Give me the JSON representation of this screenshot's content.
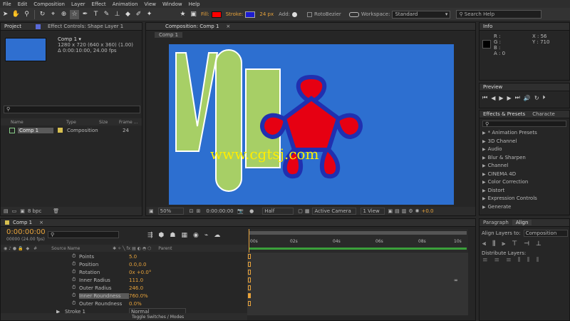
{
  "menu": [
    "File",
    "Edit",
    "Composition",
    "Layer",
    "Effect",
    "Animation",
    "View",
    "Window",
    "Help"
  ],
  "toolbar": {
    "fill_label": "Fill:",
    "fill_color": "#ff0000",
    "stroke_label": "Stroke:",
    "stroke_color": "#1c1cd0",
    "stroke_width": "24 px",
    "add_label": "Add:",
    "roto_label": "RotoBezier",
    "workspace_label": "Workspace:",
    "workspace_value": "Standard",
    "search_placeholder": "Search Help"
  },
  "project": {
    "tab_project": "Project",
    "tab_effect": "Effect Controls: Shape Layer 1",
    "comp_name": "Comp 1 ▾",
    "comp_size": "1280 x 720  (640 x 360) (1.00)",
    "comp_duration": "Δ 0:00:10:00, 24.00 fps",
    "search_icon": "⚲",
    "cols": [
      "Name",
      "Type",
      "Size",
      "Frame ..."
    ],
    "item_name": "Comp 1",
    "item_type": "Composition",
    "item_frames": "24",
    "bpc": "8 bpc"
  },
  "comp": {
    "tab": "Composition: Comp 1",
    "sub_tab": "Comp 1",
    "zoom": "50%",
    "timecode": "0:00:00:00",
    "resolution": "Half",
    "camera": "Active Camera",
    "view": "1 View",
    "exposure": "+0.0"
  },
  "watermark": "www.cgtsj.com",
  "info": {
    "tab": "Info",
    "r": "R :",
    "g": "G :",
    "b": "B :",
    "a": "A : 0",
    "x": "X : 56",
    "y": "Y : 710"
  },
  "preview": {
    "tab": "Preview"
  },
  "effects": {
    "tab1": "Effects & Presets",
    "tab2": "Characte",
    "search_icon": "⚲",
    "items": [
      "* Animation Presets",
      "3D Channel",
      "Audio",
      "Blur & Sharpen",
      "Channel",
      "CINEMA 4D",
      "Color Correction",
      "Distort",
      "Expression Controls",
      "Generate"
    ]
  },
  "align": {
    "tab1": "Paragraph",
    "tab2": "Align",
    "align_to_label": "Align Layers to:",
    "align_to_value": "Composition",
    "distribute_label": "Distribute Layers:"
  },
  "timeline": {
    "tab": "Comp 1",
    "timecode": "0:00:00:00",
    "timecode_sub": "00000 (24.00 fps)",
    "col_source": "Source Name",
    "col_parent": "Parent",
    "props": [
      {
        "name": "Points",
        "value": "5.0"
      },
      {
        "name": "Position",
        "value": "0.0,0.0"
      },
      {
        "name": "Rotation",
        "value": "0x +0.0°"
      },
      {
        "name": "Inner Radius",
        "value": "111.0"
      },
      {
        "name": "Outer Radius",
        "value": "246.0"
      },
      {
        "name": "Inner Roundness",
        "value": "760.0%"
      },
      {
        "name": "Outer Roundness",
        "value": "0.0%"
      }
    ],
    "stroke_label": "Stroke 1",
    "blend": "Normal",
    "toggle": "Toggle Switches / Modes",
    "ruler": [
      "00s",
      "02s",
      "04s",
      "06s",
      "08s",
      "10s"
    ]
  }
}
